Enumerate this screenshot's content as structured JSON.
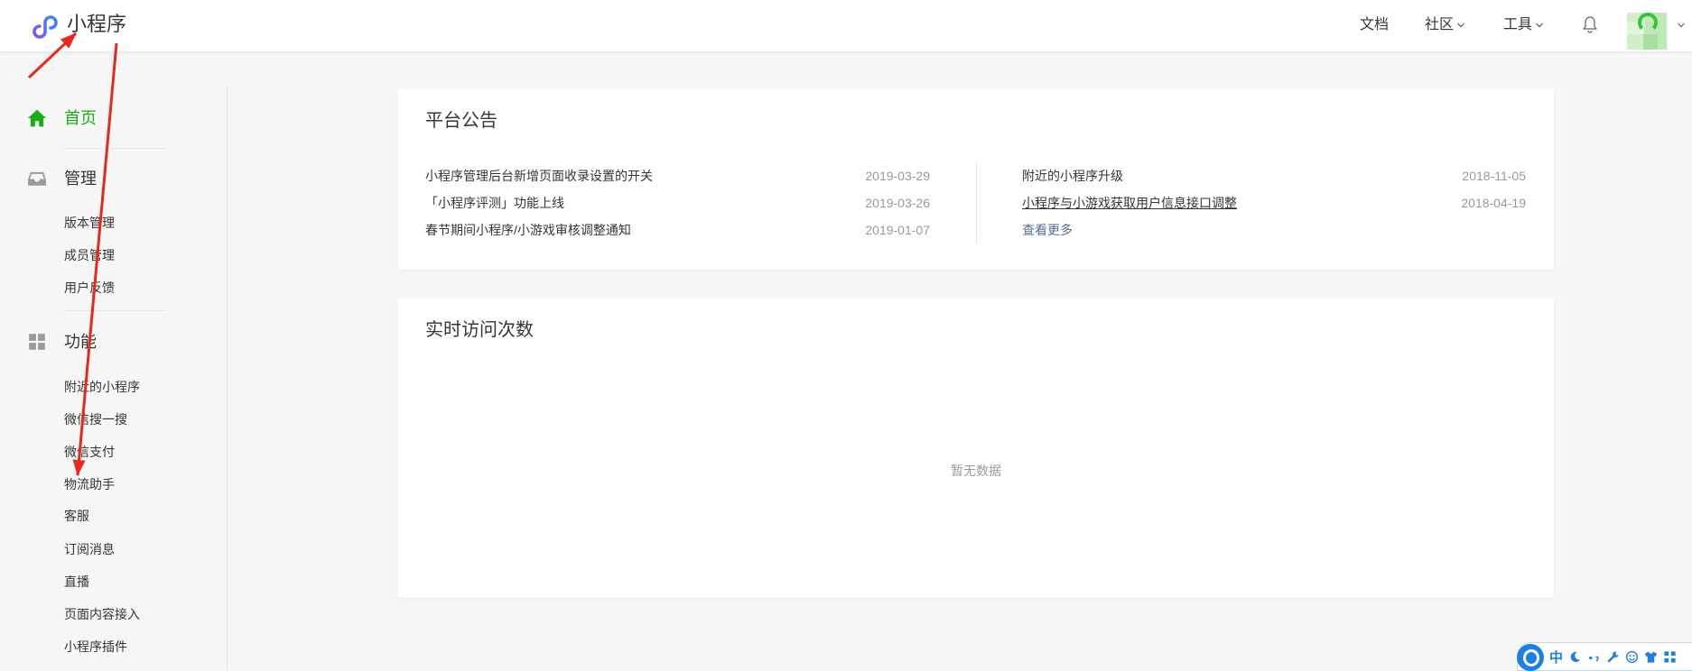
{
  "header": {
    "app_title": "小程序",
    "logo_icon": "mini-program-logo",
    "nav": [
      {
        "label": "文档"
      },
      {
        "label": "社区",
        "icon": "chevron-down-icon"
      },
      {
        "label": "工具",
        "icon": "chevron-down-icon"
      }
    ],
    "notification_icon": "bell-icon",
    "account_icon": "avatar"
  },
  "sidebar": {
    "home": {
      "label": "首页",
      "icon": "home-icon",
      "active": true
    },
    "groups": [
      {
        "title": "管理",
        "icon": "inbox-icon",
        "items": [
          "版本管理",
          "成员管理",
          "用户反馈"
        ]
      },
      {
        "title": "功能",
        "icon": "grid-icon",
        "items": [
          "附近的小程序",
          "微信搜一搜",
          "微信支付",
          "物流助手",
          "客服",
          "订阅消息",
          "直播",
          "页面内容接入",
          "小程序插件"
        ]
      }
    ]
  },
  "announcements": {
    "title": "平台公告",
    "left": [
      {
        "title": "小程序管理后台新增页面收录设置的开关",
        "date": "2019-03-29"
      },
      {
        "title": "「小程序评测」功能上线",
        "date": "2019-03-26"
      },
      {
        "title": "春节期间小程序/小游戏审核调整通知",
        "date": "2019-01-07"
      }
    ],
    "right": [
      {
        "title": "附近的小程序升级",
        "date": "2018-11-05"
      },
      {
        "title": "小程序与小游戏获取用户信息接口调整",
        "date": "2018-04-19"
      }
    ],
    "more": "查看更多"
  },
  "realtime_visits": {
    "title": "实时访问次数",
    "empty_text": "暂无数据"
  },
  "ime_toolbar": {
    "mode": "中",
    "icons": [
      "ime-logo",
      "moon-icon",
      "punctuation-icon",
      "wrench-icon",
      "smiley-icon",
      "shirt-icon",
      "grid-icon"
    ]
  },
  "colors": {
    "accent": "#1aad19",
    "link": "#576b95",
    "text": "#353535",
    "muted": "#9a9a9a",
    "annotation_arrow": "#e8281f",
    "ime_blue": "#1f7fe0"
  }
}
